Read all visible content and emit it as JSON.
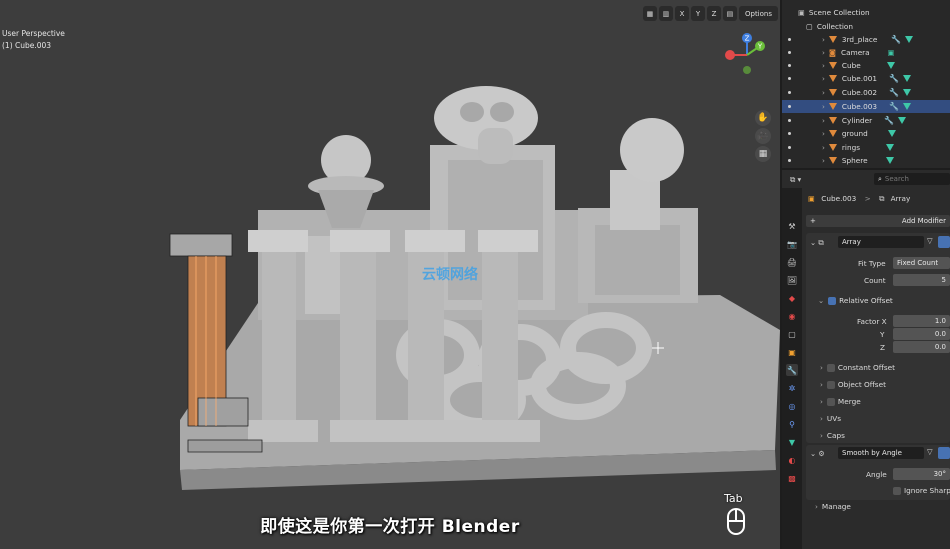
{
  "viewport": {
    "view_name": "User Perspective",
    "object_label": "(1) Cube.003",
    "header_buttons": [
      "▦",
      "▥",
      "X",
      "Y",
      "Z",
      "▤"
    ],
    "options_label": "Options",
    "gizmo": {
      "z": "Z",
      "y": "Y",
      "x_color": "#e24a4a",
      "y_color": "#6bbf3a",
      "z_color": "#3f7fe0"
    },
    "nav_icons": [
      "hand-icon",
      "camera-icon",
      "grid-icon"
    ],
    "subtitle": "即使这是你第一次打开 Blender",
    "tab_hint": "Tab",
    "watermark": "云顿网络"
  },
  "outliner": {
    "scene_collection": "Scene Collection",
    "collection": "Collection",
    "items": [
      {
        "name": "3rd_place",
        "selected": false
      },
      {
        "name": "Camera",
        "selected": false
      },
      {
        "name": "Cube",
        "selected": false
      },
      {
        "name": "Cube.001",
        "selected": false
      },
      {
        "name": "Cube.002",
        "selected": false
      },
      {
        "name": "Cube.003",
        "selected": true
      },
      {
        "name": "Cylinder",
        "selected": false
      },
      {
        "name": "ground",
        "selected": false
      },
      {
        "name": "rings",
        "selected": false
      },
      {
        "name": "Sphere",
        "selected": false
      }
    ]
  },
  "properties": {
    "search_placeholder": "Search",
    "breadcrumb_object": "Cube.003",
    "breadcrumb_sep": ">",
    "breadcrumb_modifier": "Array",
    "add_modifier": "Add Modifier",
    "modifier_name": "Array",
    "fit_type_label": "Fit Type",
    "fit_type_value": "Fixed Count",
    "count_label": "Count",
    "count_value": "5",
    "relative_offset": "Relative Offset",
    "factor_x_label": "Factor X",
    "factor_x": "1.0",
    "y_label": "Y",
    "factor_y": "0.0",
    "z_label": "Z",
    "factor_z": "0.0",
    "constant_offset": "Constant Offset",
    "object_offset": "Object Offset",
    "merge": "Merge",
    "uvs": "UVs",
    "caps": "Caps",
    "smooth_modifier": "Smooth by Angle",
    "angle_label": "Angle",
    "angle_value": "30°",
    "ignore_sharp": "Ignore Sharp",
    "manage": "Manage"
  }
}
